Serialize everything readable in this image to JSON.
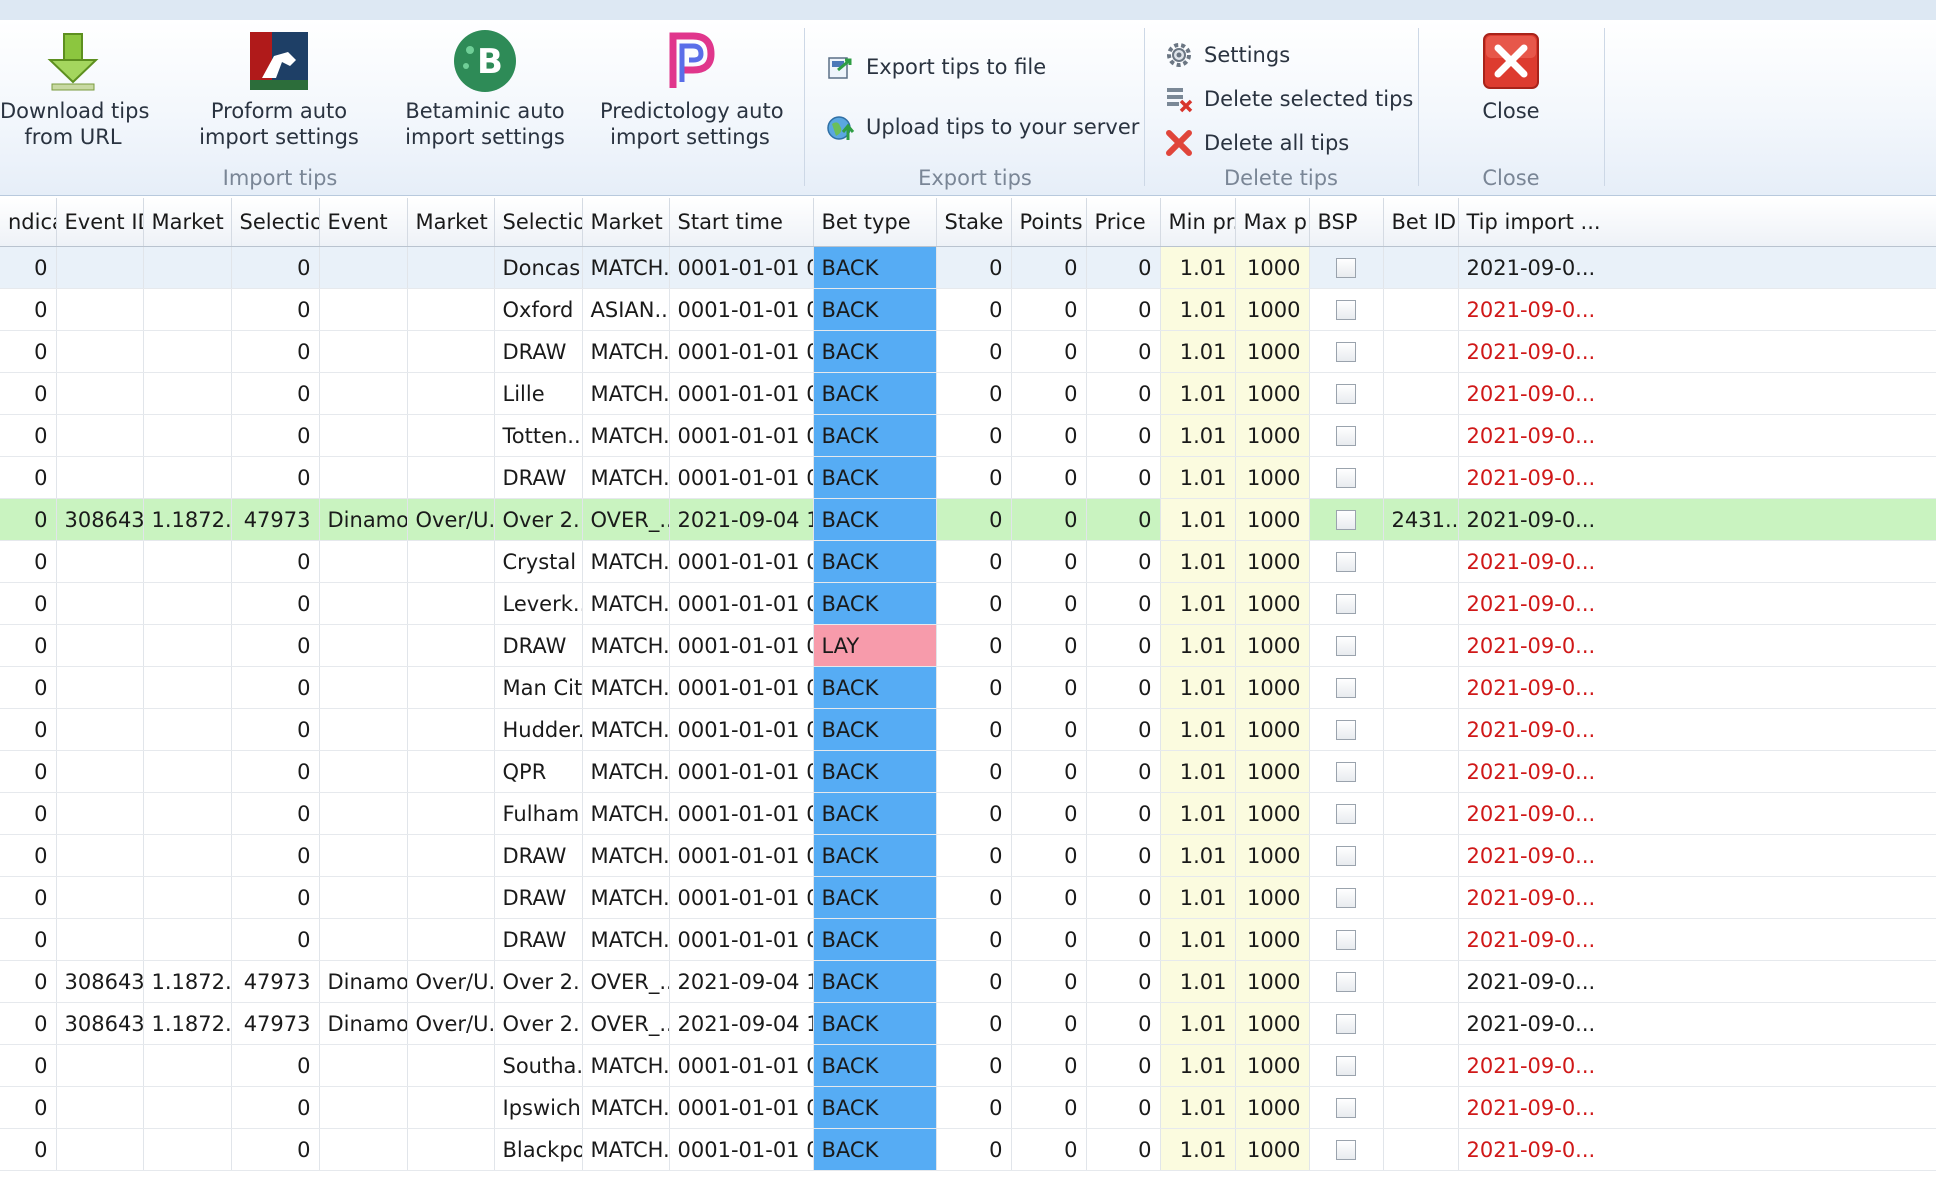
{
  "ribbon": {
    "import_group": {
      "label": "Import tips",
      "download": {
        "line1": "Download tips",
        "line2": "from URL",
        "icon": "download-arrow-icon"
      },
      "proform": {
        "line1": "Proform auto",
        "line2": "import settings",
        "icon": "proform-logo-icon"
      },
      "betaminic": {
        "line1": "Betaminic auto",
        "line2": "import settings",
        "icon": "betaminic-logo-icon",
        "glyph": "B"
      },
      "predictology": {
        "line1": "Predictology auto",
        "line2": "import settings",
        "icon": "predictology-logo-icon"
      }
    },
    "export_group": {
      "label": "Export tips",
      "export_file": "Export tips to file",
      "upload_server": "Upload tips to your server"
    },
    "delete_group": {
      "label": "Delete tips",
      "settings": "Settings",
      "delete_selected": "Delete selected tips",
      "delete_all": "Delete all tips"
    },
    "close_group": {
      "label": "Close",
      "close": "Close"
    }
  },
  "grid": {
    "columns": [
      "ndicap",
      "Event ID",
      "Market ...",
      "Selectio...",
      "Event",
      "Market",
      "Selection",
      "Market ...",
      "Start time",
      "Bet type",
      "Stake",
      "Points",
      "Price",
      "Min pr...",
      "Max p...",
      "BSP",
      "Bet ID",
      "Tip import ..."
    ],
    "rows": [
      {
        "handicap": "0",
        "event_id": "",
        "market_id": "",
        "selection_id": "0",
        "event": "",
        "market": "",
        "selection": "Doncas...",
        "market_type": "MATCH...",
        "start_time": "0001-01-01 00...",
        "bet_type": "BACK",
        "stake": "0",
        "points": "0",
        "price": "0",
        "min_price": "1.01",
        "max_price": "1000",
        "bet_id": "",
        "tip_import": "2021-09-0...",
        "import_red": false,
        "style": "sel"
      },
      {
        "handicap": "0",
        "event_id": "",
        "market_id": "",
        "selection_id": "0",
        "event": "",
        "market": "",
        "selection": "Oxford",
        "market_type": "ASIAN...",
        "start_time": "0001-01-01 00...",
        "bet_type": "BACK",
        "stake": "0",
        "points": "0",
        "price": "0",
        "min_price": "1.01",
        "max_price": "1000",
        "bet_id": "",
        "tip_import": "2021-09-0...",
        "import_red": true,
        "style": ""
      },
      {
        "handicap": "0",
        "event_id": "",
        "market_id": "",
        "selection_id": "0",
        "event": "",
        "market": "",
        "selection": "DRAW",
        "market_type": "MATCH...",
        "start_time": "0001-01-01 00...",
        "bet_type": "BACK",
        "stake": "0",
        "points": "0",
        "price": "0",
        "min_price": "1.01",
        "max_price": "1000",
        "bet_id": "",
        "tip_import": "2021-09-0...",
        "import_red": true,
        "style": ""
      },
      {
        "handicap": "0",
        "event_id": "",
        "market_id": "",
        "selection_id": "0",
        "event": "",
        "market": "",
        "selection": "Lille",
        "market_type": "MATCH...",
        "start_time": "0001-01-01 00...",
        "bet_type": "BACK",
        "stake": "0",
        "points": "0",
        "price": "0",
        "min_price": "1.01",
        "max_price": "1000",
        "bet_id": "",
        "tip_import": "2021-09-0...",
        "import_red": true,
        "style": ""
      },
      {
        "handicap": "0",
        "event_id": "",
        "market_id": "",
        "selection_id": "0",
        "event": "",
        "market": "",
        "selection": "Totten...",
        "market_type": "MATCH...",
        "start_time": "0001-01-01 00...",
        "bet_type": "BACK",
        "stake": "0",
        "points": "0",
        "price": "0",
        "min_price": "1.01",
        "max_price": "1000",
        "bet_id": "",
        "tip_import": "2021-09-0...",
        "import_red": true,
        "style": ""
      },
      {
        "handicap": "0",
        "event_id": "",
        "market_id": "",
        "selection_id": "0",
        "event": "",
        "market": "",
        "selection": "DRAW",
        "market_type": "MATCH...",
        "start_time": "0001-01-01 00...",
        "bet_type": "BACK",
        "stake": "0",
        "points": "0",
        "price": "0",
        "min_price": "1.01",
        "max_price": "1000",
        "bet_id": "",
        "tip_import": "2021-09-0...",
        "import_red": true,
        "style": ""
      },
      {
        "handicap": "0",
        "event_id": "308643...",
        "market_id": "1.1872...",
        "selection_id": "47973",
        "event": "Dinamo...",
        "market": "Over/U...",
        "selection": "Over 2....",
        "market_type": "OVER_...",
        "start_time": "2021-09-04 16...",
        "bet_type": "BACK",
        "stake": "0",
        "points": "0",
        "price": "0",
        "min_price": "1.01",
        "max_price": "1000",
        "bet_id": "2431...",
        "tip_import": "2021-09-0...",
        "import_red": false,
        "style": "green"
      },
      {
        "handicap": "0",
        "event_id": "",
        "market_id": "",
        "selection_id": "0",
        "event": "",
        "market": "",
        "selection": "Crystal ...",
        "market_type": "MATCH...",
        "start_time": "0001-01-01 00...",
        "bet_type": "BACK",
        "stake": "0",
        "points": "0",
        "price": "0",
        "min_price": "1.01",
        "max_price": "1000",
        "bet_id": "",
        "tip_import": "2021-09-0...",
        "import_red": true,
        "style": ""
      },
      {
        "handicap": "0",
        "event_id": "",
        "market_id": "",
        "selection_id": "0",
        "event": "",
        "market": "",
        "selection": "Leverk...",
        "market_type": "MATCH...",
        "start_time": "0001-01-01 00...",
        "bet_type": "BACK",
        "stake": "0",
        "points": "0",
        "price": "0",
        "min_price": "1.01",
        "max_price": "1000",
        "bet_id": "",
        "tip_import": "2021-09-0...",
        "import_red": true,
        "style": ""
      },
      {
        "handicap": "0",
        "event_id": "",
        "market_id": "",
        "selection_id": "0",
        "event": "",
        "market": "",
        "selection": "DRAW",
        "market_type": "MATCH...",
        "start_time": "0001-01-01 00...",
        "bet_type": "LAY",
        "stake": "0",
        "points": "0",
        "price": "0",
        "min_price": "1.01",
        "max_price": "1000",
        "bet_id": "",
        "tip_import": "2021-09-0...",
        "import_red": true,
        "style": ""
      },
      {
        "handicap": "0",
        "event_id": "",
        "market_id": "",
        "selection_id": "0",
        "event": "",
        "market": "",
        "selection": "Man City",
        "market_type": "MATCH...",
        "start_time": "0001-01-01 00...",
        "bet_type": "BACK",
        "stake": "0",
        "points": "0",
        "price": "0",
        "min_price": "1.01",
        "max_price": "1000",
        "bet_id": "",
        "tip_import": "2021-09-0...",
        "import_red": true,
        "style": ""
      },
      {
        "handicap": "0",
        "event_id": "",
        "market_id": "",
        "selection_id": "0",
        "event": "",
        "market": "",
        "selection": "Hudder...",
        "market_type": "MATCH...",
        "start_time": "0001-01-01 00...",
        "bet_type": "BACK",
        "stake": "0",
        "points": "0",
        "price": "0",
        "min_price": "1.01",
        "max_price": "1000",
        "bet_id": "",
        "tip_import": "2021-09-0...",
        "import_red": true,
        "style": ""
      },
      {
        "handicap": "0",
        "event_id": "",
        "market_id": "",
        "selection_id": "0",
        "event": "",
        "market": "",
        "selection": "QPR",
        "market_type": "MATCH...",
        "start_time": "0001-01-01 00...",
        "bet_type": "BACK",
        "stake": "0",
        "points": "0",
        "price": "0",
        "min_price": "1.01",
        "max_price": "1000",
        "bet_id": "",
        "tip_import": "2021-09-0...",
        "import_red": true,
        "style": ""
      },
      {
        "handicap": "0",
        "event_id": "",
        "market_id": "",
        "selection_id": "0",
        "event": "",
        "market": "",
        "selection": "Fulham",
        "market_type": "MATCH...",
        "start_time": "0001-01-01 00...",
        "bet_type": "BACK",
        "stake": "0",
        "points": "0",
        "price": "0",
        "min_price": "1.01",
        "max_price": "1000",
        "bet_id": "",
        "tip_import": "2021-09-0...",
        "import_red": true,
        "style": ""
      },
      {
        "handicap": "0",
        "event_id": "",
        "market_id": "",
        "selection_id": "0",
        "event": "",
        "market": "",
        "selection": "DRAW",
        "market_type": "MATCH...",
        "start_time": "0001-01-01 00...",
        "bet_type": "BACK",
        "stake": "0",
        "points": "0",
        "price": "0",
        "min_price": "1.01",
        "max_price": "1000",
        "bet_id": "",
        "tip_import": "2021-09-0...",
        "import_red": true,
        "style": ""
      },
      {
        "handicap": "0",
        "event_id": "",
        "market_id": "",
        "selection_id": "0",
        "event": "",
        "market": "",
        "selection": "DRAW",
        "market_type": "MATCH...",
        "start_time": "0001-01-01 00...",
        "bet_type": "BACK",
        "stake": "0",
        "points": "0",
        "price": "0",
        "min_price": "1.01",
        "max_price": "1000",
        "bet_id": "",
        "tip_import": "2021-09-0...",
        "import_red": true,
        "style": ""
      },
      {
        "handicap": "0",
        "event_id": "",
        "market_id": "",
        "selection_id": "0",
        "event": "",
        "market": "",
        "selection": "DRAW",
        "market_type": "MATCH...",
        "start_time": "0001-01-01 00...",
        "bet_type": "BACK",
        "stake": "0",
        "points": "0",
        "price": "0",
        "min_price": "1.01",
        "max_price": "1000",
        "bet_id": "",
        "tip_import": "2021-09-0...",
        "import_red": true,
        "style": ""
      },
      {
        "handicap": "0",
        "event_id": "308643...",
        "market_id": "1.1872...",
        "selection_id": "47973",
        "event": "Dinamo...",
        "market": "Over/U...",
        "selection": "Over 2....",
        "market_type": "OVER_...",
        "start_time": "2021-09-04 16...",
        "bet_type": "BACK",
        "stake": "0",
        "points": "0",
        "price": "0",
        "min_price": "1.01",
        "max_price": "1000",
        "bet_id": "",
        "tip_import": "2021-09-0...",
        "import_red": false,
        "style": ""
      },
      {
        "handicap": "0",
        "event_id": "308643...",
        "market_id": "1.1872...",
        "selection_id": "47973",
        "event": "Dinamo...",
        "market": "Over/U...",
        "selection": "Over 2....",
        "market_type": "OVER_...",
        "start_time": "2021-09-04 16...",
        "bet_type": "BACK",
        "stake": "0",
        "points": "0",
        "price": "0",
        "min_price": "1.01",
        "max_price": "1000",
        "bet_id": "",
        "tip_import": "2021-09-0...",
        "import_red": false,
        "style": ""
      },
      {
        "handicap": "0",
        "event_id": "",
        "market_id": "",
        "selection_id": "0",
        "event": "",
        "market": "",
        "selection": "Southa...",
        "market_type": "MATCH...",
        "start_time": "0001-01-01 00...",
        "bet_type": "BACK",
        "stake": "0",
        "points": "0",
        "price": "0",
        "min_price": "1.01",
        "max_price": "1000",
        "bet_id": "",
        "tip_import": "2021-09-0...",
        "import_red": true,
        "style": ""
      },
      {
        "handicap": "0",
        "event_id": "",
        "market_id": "",
        "selection_id": "0",
        "event": "",
        "market": "",
        "selection": "Ipswich",
        "market_type": "MATCH...",
        "start_time": "0001-01-01 00...",
        "bet_type": "BACK",
        "stake": "0",
        "points": "0",
        "price": "0",
        "min_price": "1.01",
        "max_price": "1000",
        "bet_id": "",
        "tip_import": "2021-09-0...",
        "import_red": true,
        "style": ""
      },
      {
        "handicap": "0",
        "event_id": "",
        "market_id": "",
        "selection_id": "0",
        "event": "",
        "market": "",
        "selection": "Blackpool",
        "market_type": "MATCH...",
        "start_time": "0001-01-01 00...",
        "bet_type": "BACK",
        "stake": "0",
        "points": "0",
        "price": "0",
        "min_price": "1.01",
        "max_price": "1000",
        "bet_id": "",
        "tip_import": "2021-09-0...",
        "import_red": true,
        "style": ""
      }
    ]
  },
  "colors": {
    "back": "#56acf4",
    "lay": "#f79bab",
    "highlight_row": "#c9f3c0",
    "minmax_bg": "#fbfbdf",
    "import_red": "#d01818"
  }
}
